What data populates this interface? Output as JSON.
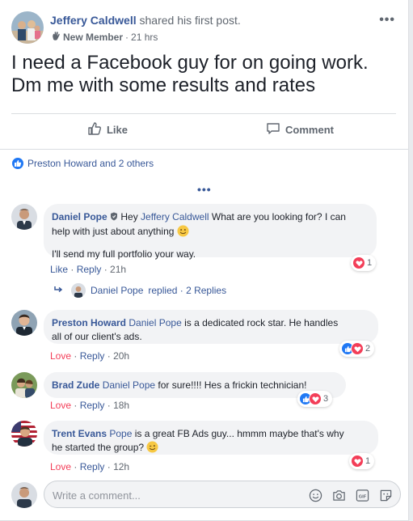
{
  "post": {
    "author": "Jeffery Caldwell",
    "action": "shared his first post.",
    "badge": "New Member",
    "separator": "·",
    "time": "21 hrs",
    "more": "•••",
    "text_line1": "I need a Facebook guy for on going work.",
    "text_line2": "Dm me with some results and rates"
  },
  "actions": {
    "like": "Like",
    "comment": "Comment"
  },
  "reactions": {
    "summary": "Preston Howard and 2 others",
    "more_comments": "•••"
  },
  "comments": [
    {
      "name": "Daniel Pope",
      "text_before": " Hey ",
      "mention": "Jeffery Caldwell",
      "text_after": " What are you looking for? I can",
      "text_line2": "help with just about anything",
      "text_para2": "I'll send my full portfolio your way.",
      "action1": "Like",
      "action2": "Reply",
      "time": "21h",
      "reaction_count": "1"
    },
    {
      "name": "Preston Howard",
      "mention": "Daniel Pope",
      "text_after": " is a dedicated rock star. He handles",
      "text_line2": "all of our client's ads.",
      "action1": "Love",
      "action2": "Reply",
      "time": "20h",
      "reaction_count": "2"
    },
    {
      "name": "Brad Zude",
      "mention": "Daniel Pope",
      "text_after": " for sure!!!! Hes a frickin technician!",
      "action1": "Love",
      "action2": "Reply",
      "time": "18h",
      "reaction_count": "3"
    },
    {
      "name": "Trent Evans",
      "mention": "Pope",
      "text_after": " is a great FB Ads guy... hmmm maybe that's why",
      "text_line2": "he started the group?",
      "action1": "Love",
      "action2": "Reply",
      "time": "12h",
      "reaction_count": "1"
    }
  ],
  "reply_summary": {
    "name": "Daniel Pope",
    "rest": "replied · 2 Replies"
  },
  "compose": {
    "placeholder": "Write a comment..."
  },
  "colors": {
    "link": "#385898",
    "love": "#f33e58",
    "like": "#2078f4",
    "muted": "#606770"
  }
}
